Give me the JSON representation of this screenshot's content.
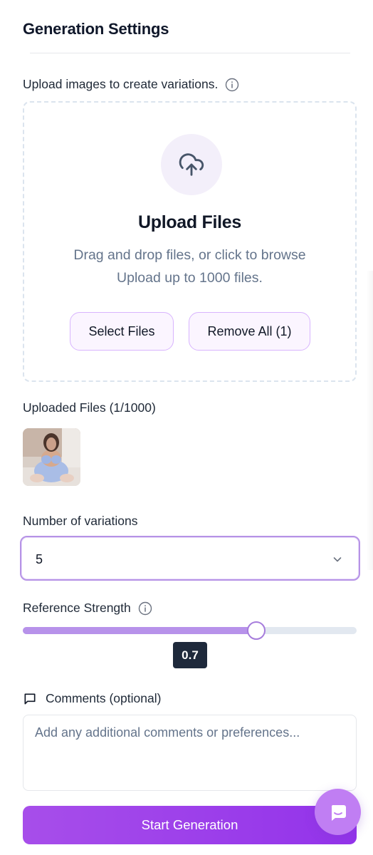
{
  "header": {
    "title": "Generation Settings"
  },
  "upload": {
    "label": "Upload images to create variations.",
    "info_icon": "info-circle-icon",
    "upload_icon": "cloud-upload-icon",
    "title": "Upload Files",
    "line1": "Drag and drop files, or click to browse",
    "line2": "Upload up to 1000 files.",
    "select_button": "Select Files",
    "remove_button": "Remove All (1)"
  },
  "uploaded": {
    "label": "Uploaded Files (1/1000)"
  },
  "variations": {
    "label": "Number of variations",
    "value": "5"
  },
  "strength": {
    "label": "Reference Strength",
    "value": 0.7,
    "value_text": "0.7",
    "min": 0,
    "max": 1
  },
  "comments": {
    "label": "Comments (optional)",
    "icon": "message-square-icon",
    "placeholder": "Add any additional comments or preferences..."
  },
  "actions": {
    "start_label": "Start Generation"
  },
  "chat": {
    "icon": "chat-bubble-icon"
  },
  "colors": {
    "accent": "#9333ea",
    "slider_fill": "#b792ea",
    "button_tint": "#fbf5ff"
  }
}
